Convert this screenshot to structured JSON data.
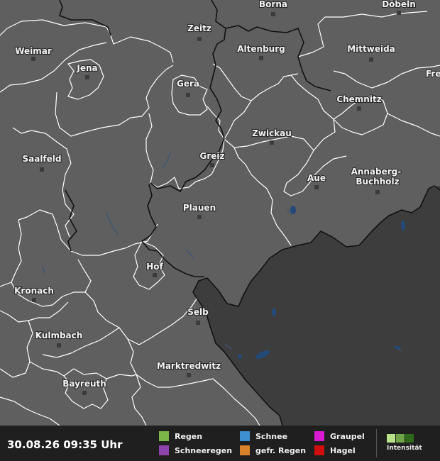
{
  "map": {
    "colors": {
      "land": "#5f5f5f",
      "masked": "#3d3d3d",
      "state_border": "#ffffff",
      "country_border": "#111111",
      "water": "#234a78"
    },
    "cities": [
      {
        "id": "borna",
        "name": "Borna"
      },
      {
        "id": "doebeln",
        "name": "Döbeln"
      },
      {
        "id": "zeitz",
        "name": "Zeitz"
      },
      {
        "id": "weimar",
        "name": "Weimar"
      },
      {
        "id": "altenburg",
        "name": "Altenburg"
      },
      {
        "id": "mittweida",
        "name": "Mittweida"
      },
      {
        "id": "freiberg",
        "name": "Frei"
      },
      {
        "id": "jena",
        "name": "Jena"
      },
      {
        "id": "gera",
        "name": "Gera"
      },
      {
        "id": "chemnitz",
        "name": "Chemnitz"
      },
      {
        "id": "zwickau",
        "name": "Zwickau"
      },
      {
        "id": "saalfeld",
        "name": "Saalfeld"
      },
      {
        "id": "greiz",
        "name": "Greiz"
      },
      {
        "id": "annaberg",
        "name": "Annaberg-\nBuchholz"
      },
      {
        "id": "aue",
        "name": "Aue"
      },
      {
        "id": "plauen",
        "name": "Plauen"
      },
      {
        "id": "hof",
        "name": "Hof"
      },
      {
        "id": "kronach",
        "name": "Kronach"
      },
      {
        "id": "selb",
        "name": "Selb"
      },
      {
        "id": "kulmbach",
        "name": "Kulmbach"
      },
      {
        "id": "marktredwitz",
        "name": "Marktredwitz"
      },
      {
        "id": "bayreuth",
        "name": "Bayreuth"
      }
    ]
  },
  "footer": {
    "timestamp": "30.08.26 09:35 Uhr",
    "legend": [
      {
        "id": "regen",
        "label": "Regen",
        "color": "#7ab648"
      },
      {
        "id": "schneeregen",
        "label": "Schneeregen",
        "color": "#8e44ad"
      },
      {
        "id": "schnee",
        "label": "Schnee",
        "color": "#3d8fd1"
      },
      {
        "id": "gefr-regen",
        "label": "gefr. Regen",
        "color": "#d9822b"
      },
      {
        "id": "graupel",
        "label": "Graupel",
        "color": "#d81ad1"
      },
      {
        "id": "hagel",
        "label": "Hagel",
        "color": "#d10e0e"
      }
    ],
    "intensity_label": "Intensität",
    "intensity_colors": [
      "#b8e28a",
      "#6fa544",
      "#2f6a1c"
    ]
  }
}
